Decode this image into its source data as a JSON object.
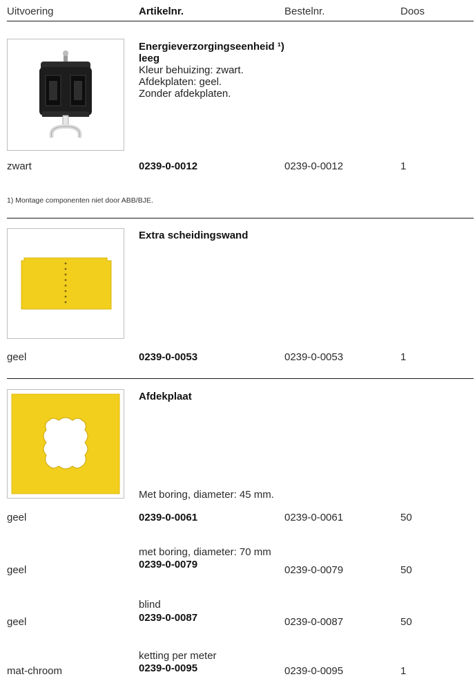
{
  "header": {
    "col_uitvoering": "Uitvoering",
    "col_artikelnr": "Artikelnr.",
    "col_bestelnr": "Bestelnr.",
    "col_doos": "Doos"
  },
  "section1": {
    "title_line1": "Energieverzorgingseenheid ¹)",
    "title_line2": "leeg",
    "desc_lines": [
      "Kleur behuizing: zwart.",
      "Afdekplaten: geel.",
      "Zonder afdekplaten."
    ],
    "row": {
      "uitvoering": "zwart",
      "artikelnr": "0239-0-0012",
      "bestelnr": "0239-0-0012",
      "doos": "1"
    },
    "footnote": "1)  Montage componenten niet door ABB/BJE."
  },
  "section2": {
    "title": "Extra scheidingswand",
    "row": {
      "uitvoering": "geel",
      "artikelnr": "0239-0-0053",
      "bestelnr": "0239-0-0053",
      "doos": "1"
    }
  },
  "section3": {
    "title": "Afdekplaat",
    "rows": [
      {
        "desc": "Met boring, diameter: 45 mm.",
        "uitvoering": "geel",
        "artikelnr": "0239-0-0061",
        "bestelnr": "0239-0-0061",
        "doos": "50"
      },
      {
        "desc": "met boring, diameter: 70 mm",
        "uitvoering": "geel",
        "artikelnr": "0239-0-0079",
        "bestelnr": "0239-0-0079",
        "doos": "50"
      },
      {
        "desc": "blind",
        "uitvoering": "geel",
        "artikelnr": "0239-0-0087",
        "bestelnr": "0239-0-0087",
        "doos": "50"
      },
      {
        "desc": "ketting per meter",
        "uitvoering": "mat-chroom",
        "artikelnr": "0239-0-0095",
        "bestelnr": "0239-0-0095",
        "doos": "1"
      }
    ]
  },
  "colors": {
    "yellow": "#f2cf1d",
    "black_housing": "#1d1d1d",
    "rule": "#1a1a1a"
  }
}
